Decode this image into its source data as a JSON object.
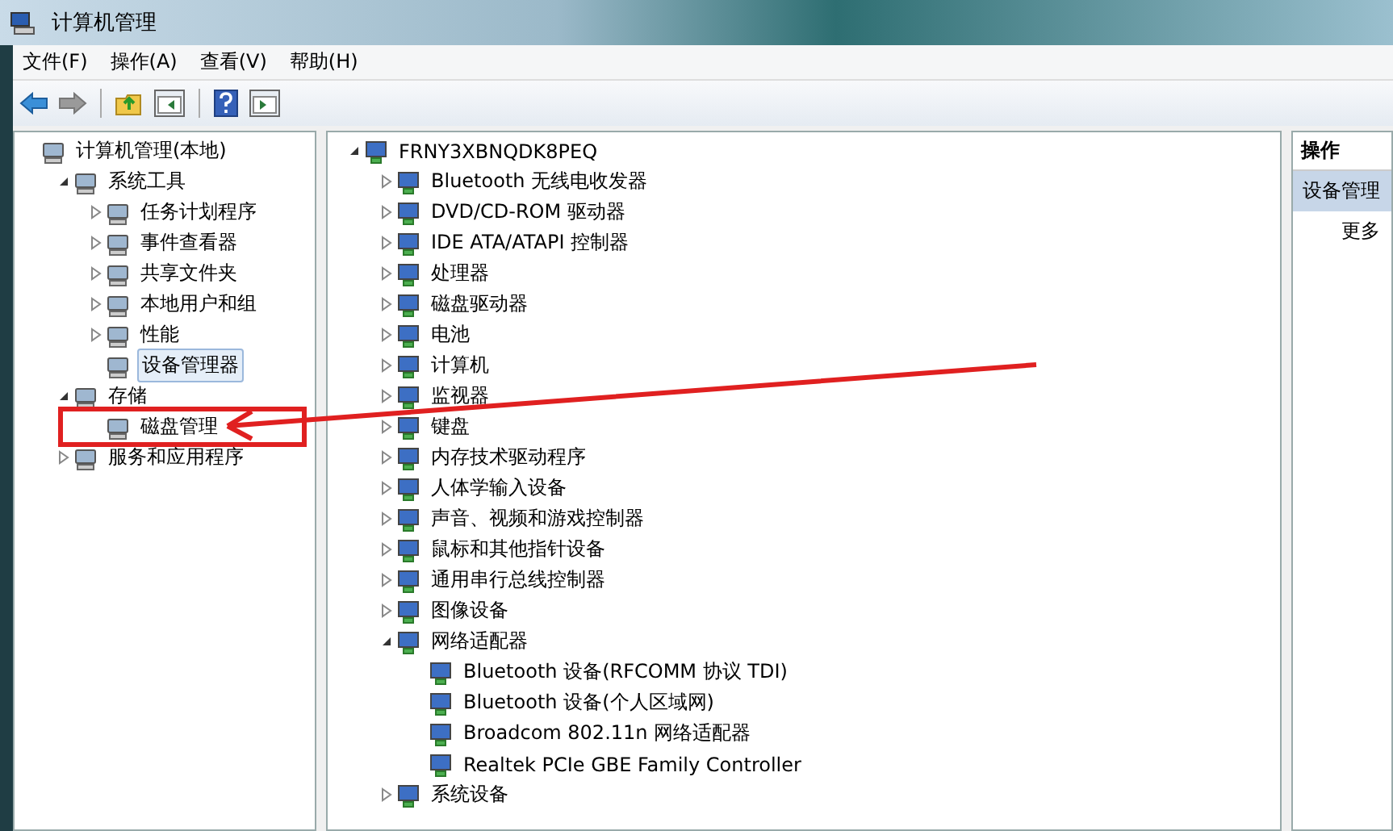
{
  "window": {
    "title": "计算机管理"
  },
  "menu": [
    "文件(F)",
    "操作(A)",
    "查看(V)",
    "帮助(H)"
  ],
  "left_tree": [
    {
      "label": "计算机管理(本地)",
      "selected": false,
      "children": [
        {
          "label": "系统工具",
          "expanded": true,
          "selected": false,
          "children": [
            {
              "label": "任务计划程序",
              "expanded": false,
              "selected": false
            },
            {
              "label": "事件查看器",
              "expanded": false,
              "selected": false
            },
            {
              "label": "共享文件夹",
              "expanded": false,
              "selected": false
            },
            {
              "label": "本地用户和组",
              "expanded": false,
              "selected": false
            },
            {
              "label": "性能",
              "expanded": false,
              "selected": false
            },
            {
              "label": "设备管理器",
              "selected": true
            }
          ]
        },
        {
          "label": "存储",
          "expanded": true,
          "selected": false,
          "children": [
            {
              "label": "磁盘管理",
              "selected": false
            }
          ]
        },
        {
          "label": "服务和应用程序",
          "expanded": false,
          "selected": false
        }
      ]
    }
  ],
  "device_tree": [
    {
      "label": "FRNY3XBNQDK8PEQ",
      "expanded": true,
      "children": [
        {
          "label": "Bluetooth 无线电收发器",
          "expanded": false
        },
        {
          "label": "DVD/CD-ROM 驱动器",
          "expanded": false
        },
        {
          "label": "IDE ATA/ATAPI 控制器",
          "expanded": false
        },
        {
          "label": "处理器",
          "expanded": false
        },
        {
          "label": "磁盘驱动器",
          "expanded": false
        },
        {
          "label": "电池",
          "expanded": false
        },
        {
          "label": "计算机",
          "expanded": false
        },
        {
          "label": "监视器",
          "expanded": false
        },
        {
          "label": "键盘",
          "expanded": false
        },
        {
          "label": "内存技术驱动程序",
          "expanded": false
        },
        {
          "label": "人体学输入设备",
          "expanded": false
        },
        {
          "label": "声音、视频和游戏控制器",
          "expanded": false
        },
        {
          "label": "鼠标和其他指针设备",
          "expanded": false
        },
        {
          "label": "通用串行总线控制器",
          "expanded": false
        },
        {
          "label": "图像设备",
          "expanded": false
        },
        {
          "label": "网络适配器",
          "expanded": true,
          "children": [
            {
              "label": "Bluetooth 设备(RFCOMM 协议 TDI)"
            },
            {
              "label": "Bluetooth 设备(个人区域网)"
            },
            {
              "label": "Broadcom 802.11n 网络适配器"
            },
            {
              "label": "Realtek PCIe GBE Family Controller"
            }
          ]
        },
        {
          "label": "系统设备",
          "expanded": false
        }
      ]
    }
  ],
  "actions": {
    "header": "操作",
    "items": [
      {
        "label": "设备管理",
        "kind": "section"
      },
      {
        "label": "更多",
        "kind": "item"
      }
    ]
  }
}
